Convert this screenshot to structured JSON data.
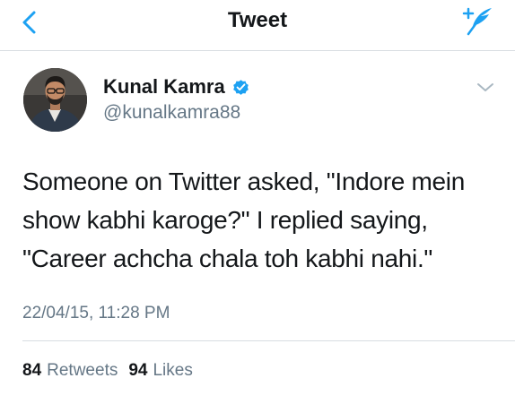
{
  "nav": {
    "title": "Tweet",
    "back_icon": "chevron-left-icon",
    "compose_icon": "compose-tweet-icon"
  },
  "author": {
    "name": "Kunal Kamra",
    "handle": "@kunalkamra88",
    "verified": true,
    "verified_icon": "verified-badge-icon"
  },
  "tweet": {
    "lines": [
      "Someone on Twitter asked, \"Indore mein",
      "show kabhi karoge?\" I replied saying,",
      "\"Career achcha chala toh kabhi nahi.\""
    ],
    "timestamp": "22/04/15, 11:28 PM"
  },
  "stats": {
    "retweets_count": "84",
    "retweets_label": "Retweets",
    "likes_count": "94",
    "likes_label": "Likes"
  },
  "colors": {
    "accent": "#1da1f2",
    "text_primary": "#14171a",
    "text_secondary": "#657786",
    "divider": "#d8dde1"
  }
}
